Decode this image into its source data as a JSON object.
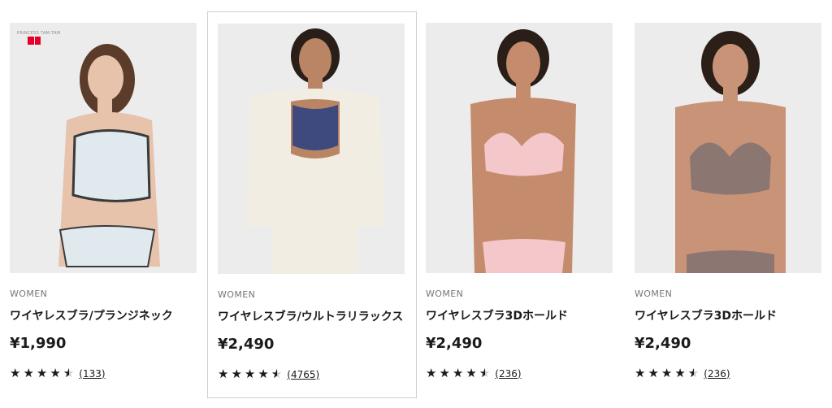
{
  "products": [
    {
      "gender": "WOMEN",
      "name": "ワイヤレスブラ/プランジネック",
      "price": "¥1,990",
      "rating": "4.5",
      "review_count": "(133)",
      "badge": "PRINCESS TAM.TAM",
      "bra_color": "#dfe9ee",
      "bra_trim": "#3a3a3a",
      "skin": "#e7c3ac"
    },
    {
      "gender": "WOMEN",
      "name": "ワイヤレスブラ/ウルトラリラックス",
      "price": "¥2,490",
      "rating": "4.5",
      "review_count": "(4765)",
      "bra_color": "#3e4a7e",
      "skin": "#b98564"
    },
    {
      "gender": "WOMEN",
      "name": "ワイヤレスブラ3Dホールド",
      "price": "¥2,490",
      "rating": "4.5",
      "review_count": "(236)",
      "bra_color": "#f4c7cb",
      "skin": "#c48c6c"
    },
    {
      "gender": "WOMEN",
      "name": "ワイヤレスブラ3Dホールド",
      "price": "¥2,490",
      "rating": "4.5",
      "review_count": "(236)",
      "bra_color": "#8b7672",
      "skin": "#c99378"
    }
  ],
  "colors": {
    "image_bg": "#ececec",
    "hover_border": "#cfcfcf",
    "logo_red": "#e4002b"
  }
}
